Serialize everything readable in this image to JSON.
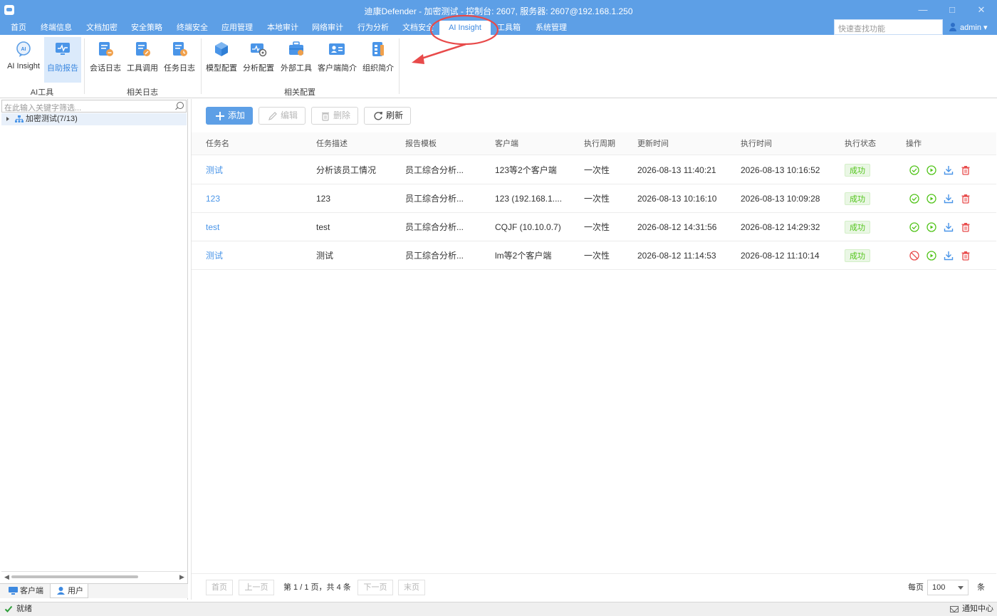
{
  "window": {
    "title": "迪康Defender - 加密测试 - 控制台: 2607, 服务器: 2607@192.168.1.250",
    "controls": [
      "minimize-icon",
      "maximize-icon",
      "close-icon"
    ]
  },
  "menu": {
    "items": [
      "首页",
      "终端信息",
      "文档加密",
      "安全策略",
      "终端安全",
      "应用管理",
      "本地审计",
      "网络审计",
      "行为分析",
      "文档安全",
      "AI Insight",
      "工具箱",
      "系统管理"
    ],
    "active": "AI Insight",
    "search_placeholder": "快速查找功能",
    "user": "admin"
  },
  "ribbon": {
    "groups": [
      {
        "label": "AI工具",
        "buttons": [
          {
            "label": "AI Insight",
            "icon": "ai-chat-icon"
          },
          {
            "label": "自助报告",
            "icon": "monitor-report-icon",
            "active": true
          }
        ]
      },
      {
        "label": "相关日志",
        "buttons": [
          {
            "label": "会话日志",
            "icon": "session-log-icon"
          },
          {
            "label": "工具调用",
            "icon": "tool-call-icon"
          },
          {
            "label": "任务日志",
            "icon": "task-log-icon"
          }
        ]
      },
      {
        "label": "相关配置",
        "buttons": [
          {
            "label": "模型配置",
            "icon": "model-cube-icon"
          },
          {
            "label": "分析配置",
            "icon": "analysis-config-icon"
          },
          {
            "label": "外部工具",
            "icon": "toolbox-icon"
          },
          {
            "label": "客户端简介",
            "icon": "client-card-icon"
          },
          {
            "label": "组织简介",
            "icon": "org-doc-icon"
          }
        ]
      }
    ]
  },
  "left": {
    "filter_placeholder": "在此输入关键字筛选...",
    "tree_root": "加密测试(7/13)",
    "tabs": [
      "客户端",
      "用户"
    ],
    "active_tab": "用户"
  },
  "toolbar": {
    "add": "添加",
    "edit": "编辑",
    "delete": "删除",
    "refresh": "刷新"
  },
  "table": {
    "columns": [
      "任务名",
      "任务描述",
      "报告模板",
      "客户端",
      "执行周期",
      "更新时间",
      "执行时间",
      "执行状态",
      "操作"
    ],
    "rows": [
      {
        "name": "测试",
        "desc": "分析该员工情况",
        "template": "员工综合分析...",
        "client": "123等2个客户端",
        "cycle": "一次性",
        "updated": "2026-08-13 11:40:21",
        "executed": "2026-08-13 10:16:52",
        "status": "成功",
        "enabled": true
      },
      {
        "name": "123",
        "desc": "123",
        "template": "员工综合分析...",
        "client": "123 (192.168.1....",
        "cycle": "一次性",
        "updated": "2026-08-13 10:16:10",
        "executed": "2026-08-13 10:09:28",
        "status": "成功",
        "enabled": true
      },
      {
        "name": "test",
        "desc": "test",
        "template": "员工综合分析...",
        "client": "CQJF (10.10.0.7)",
        "cycle": "一次性",
        "updated": "2026-08-12 14:31:56",
        "executed": "2026-08-12 14:29:32",
        "status": "成功",
        "enabled": true
      },
      {
        "name": "测试",
        "desc": "测试",
        "template": "员工综合分析...",
        "client": "lm等2个客户端",
        "cycle": "一次性",
        "updated": "2026-08-12 11:14:53",
        "executed": "2026-08-12 11:10:14",
        "status": "成功",
        "enabled": false
      }
    ]
  },
  "pager": {
    "first": "首页",
    "prev": "上一页",
    "info": "第 1 / 1 页，共 4 条",
    "next": "下一页",
    "last": "末页",
    "per_page_label": "每页",
    "per_page": "100",
    "unit": "条"
  },
  "status": {
    "text": "就绪",
    "notice": "通知中心"
  },
  "colors": {
    "accent": "#5d9fe6",
    "link": "#4a95e8",
    "success": "#52c41a",
    "danger": "#e84c4c",
    "annotation": "#e84a4a"
  }
}
